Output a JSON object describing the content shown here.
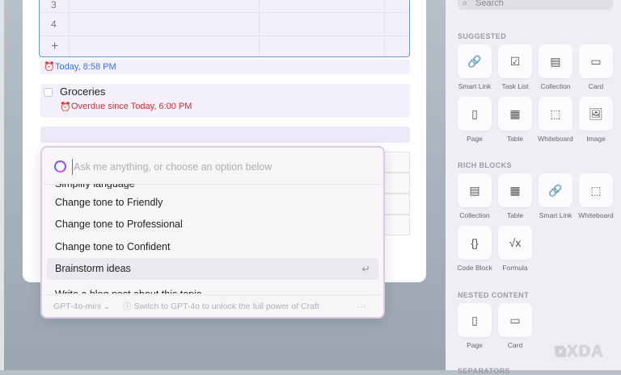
{
  "document": {
    "table": {
      "rows": [
        "3",
        "4"
      ],
      "add_label": "+"
    },
    "timestamp": "Today, 8:58 PM",
    "task": {
      "title": "Groceries",
      "due": "Overdue since Today, 6:00 PM"
    }
  },
  "ai_dialog": {
    "placeholder": "Ask me anything, or choose an option below",
    "items": [
      "Change tone to Friendly",
      "Change tone to Professional",
      "Change tone to Confident",
      "Brainstorm ideas"
    ],
    "clipped_top": "Simplify language",
    "clipped_bottom": "Write a blog post about this topic",
    "return_icon": "↵",
    "model": "GPT-4o-mini",
    "upgrade_hint": "Switch to GPT-4o to unlock the full power of Craft",
    "more": "···"
  },
  "sidebar": {
    "search_placeholder": "Search",
    "sections": [
      {
        "title": "SUGGESTED",
        "items": [
          "Smart Link",
          "Task List",
          "Collection",
          "Card",
          "Page",
          "Table",
          "Whiteboard",
          "Image"
        ]
      },
      {
        "title": "RICH BLOCKS",
        "items": [
          "Collection",
          "Table",
          "Smart Link",
          "Whiteboard",
          "Code Block",
          "Formula"
        ]
      },
      {
        "title": "NESTED CONTENT",
        "items": [
          "Page",
          "Card"
        ]
      },
      {
        "title": "SEPARATORS",
        "items": []
      }
    ]
  },
  "watermark": "XDA"
}
